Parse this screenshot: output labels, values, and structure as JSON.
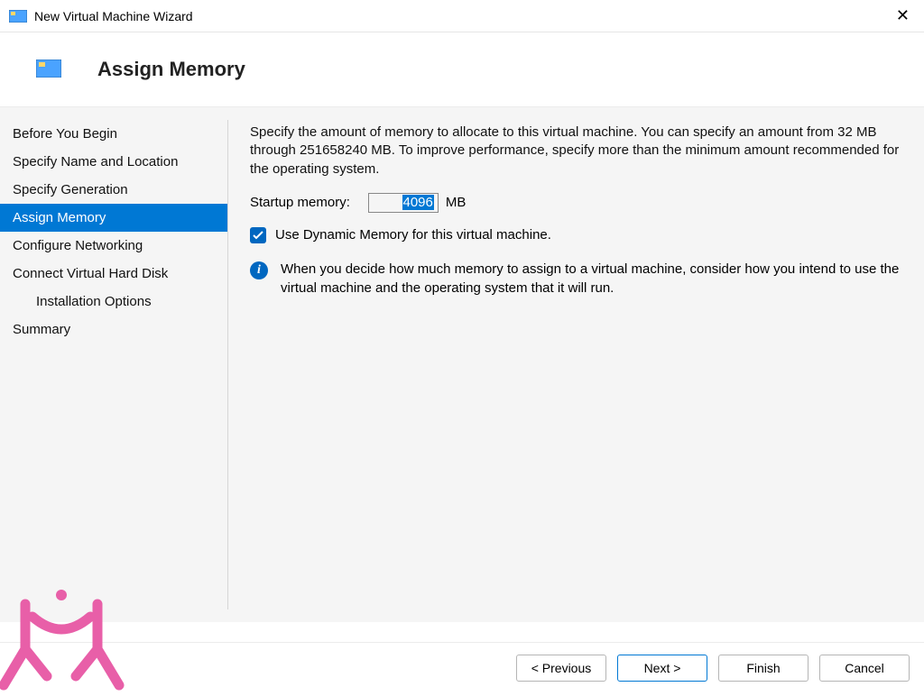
{
  "window": {
    "title": "New Virtual Machine Wizard"
  },
  "header": {
    "title": "Assign Memory"
  },
  "sidebar": {
    "items": [
      {
        "label": "Before You Begin",
        "active": false,
        "sub": false
      },
      {
        "label": "Specify Name and Location",
        "active": false,
        "sub": false
      },
      {
        "label": "Specify Generation",
        "active": false,
        "sub": false
      },
      {
        "label": "Assign Memory",
        "active": true,
        "sub": false
      },
      {
        "label": "Configure Networking",
        "active": false,
        "sub": false
      },
      {
        "label": "Connect Virtual Hard Disk",
        "active": false,
        "sub": false
      },
      {
        "label": "Installation Options",
        "active": false,
        "sub": true
      },
      {
        "label": "Summary",
        "active": false,
        "sub": false
      }
    ]
  },
  "content": {
    "intro": "Specify the amount of memory to allocate to this virtual machine. You can specify an amount from 32 MB through 251658240 MB. To improve performance, specify more than the minimum amount recommended for the operating system.",
    "startup_label": "Startup memory:",
    "startup_value": "4096",
    "startup_unit": "MB",
    "dynamic_label": "Use Dynamic Memory for this virtual machine.",
    "info_text": "When you decide how much memory to assign to a virtual machine, consider how you intend to use the virtual machine and the operating system that it will run."
  },
  "footer": {
    "previous": "< Previous",
    "next": "Next >",
    "finish": "Finish",
    "cancel": "Cancel"
  }
}
